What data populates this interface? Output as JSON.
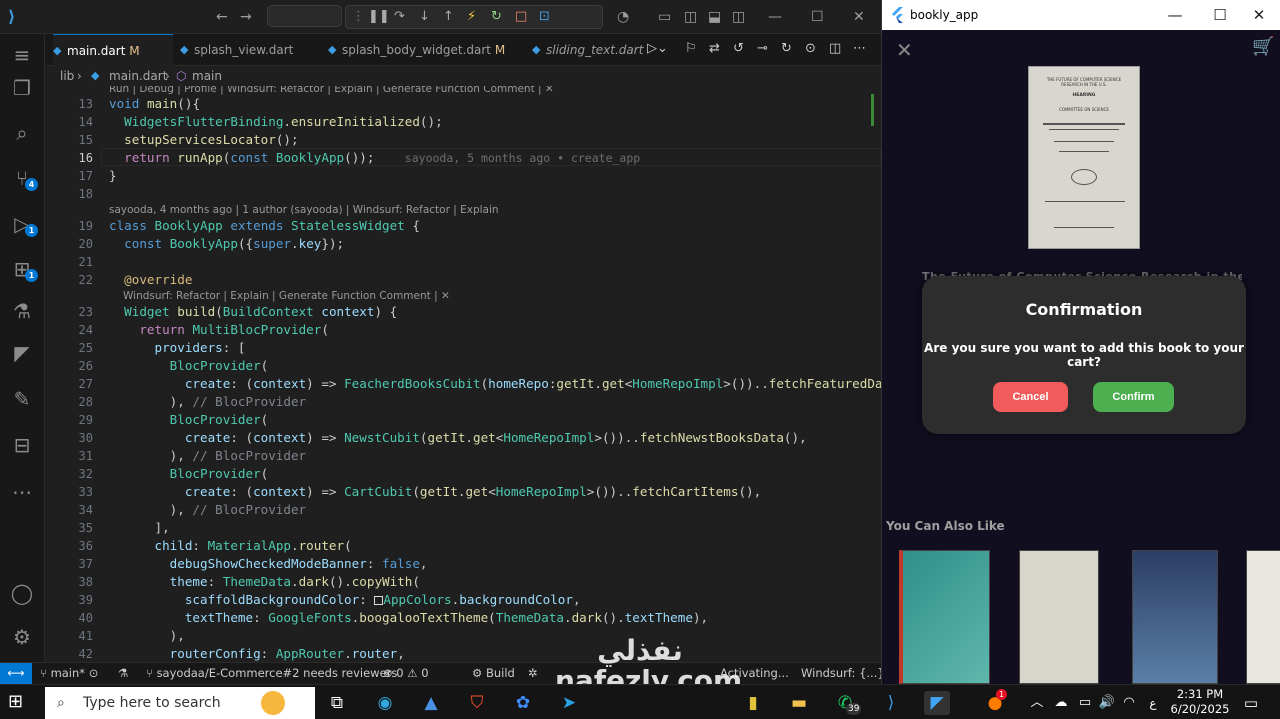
{
  "vscode": {
    "tabs": [
      {
        "label": "main.dart",
        "mod": "M",
        "active": true
      },
      {
        "label": "splash_view.dart",
        "mod": ""
      },
      {
        "label": "splash_body_widget.dart",
        "mod": "M"
      },
      {
        "label": "sliding_text.dart",
        "mod": ""
      }
    ],
    "breadcrumb": {
      "folder": "lib",
      "file": "main.dart",
      "symbol": "main"
    },
    "badges": {
      "scm": "4",
      "run": "1",
      "ext": "1"
    },
    "lens1": "Run | Debug | Profile | Windsurf: Refactor | Explain | Generate Function Comment | ✕",
    "lens2": "sayooda, 4 months ago | 1 author (sayooda) | Windsurf: Refactor | Explain",
    "lens3": "Windsurf: Refactor | Explain | Generate Function Comment | ✕",
    "blame": "sayooda, 5 months ago • create_app",
    "line_numbers": [
      "13",
      "14",
      "15",
      "16",
      "17",
      "18",
      "19",
      "20",
      "21",
      "22",
      "23",
      "24",
      "25",
      "26",
      "27",
      "28",
      "29",
      "30",
      "31",
      "32",
      "33",
      "34",
      "35",
      "36",
      "37",
      "38",
      "39",
      "40",
      "41",
      "42"
    ],
    "status": {
      "branch": "main*",
      "pr": "sayodaa/E-Commerce#2 needs reviewers",
      "problems": "⊗ 0 ⚠ 0",
      "build": "Build",
      "activating": "Activating...",
      "windsurf": "Windsurf: {...}"
    }
  },
  "app": {
    "window_title": "bookly_app",
    "hidden_title": "The Future of Computer Science Research in the U.S.",
    "dialog": {
      "title": "Confirmation",
      "message": "Are you sure you want to add this book to your cart?",
      "cancel": "Cancel",
      "confirm": "Confirm"
    },
    "section": "You Can Also Like",
    "book_lines": [
      "THE FUTURE OF COMPUTER SCIENCE RESEARCH IN THE U.S.",
      "HEARING",
      "COMMITTEE ON SCIENCE"
    ]
  },
  "taskbar": {
    "search_placeholder": "Type here to search",
    "whatsapp_badge": "39",
    "notif_badge": "1",
    "lang": "ع",
    "time": "2:31 PM",
    "date": "6/20/2025"
  },
  "watermark": "نفذلي nafezly.com",
  "colors": {
    "accent": "#0078d4",
    "cancel": "#f15b5b",
    "confirm": "#4caf50",
    "app_bg": "#110e20"
  }
}
